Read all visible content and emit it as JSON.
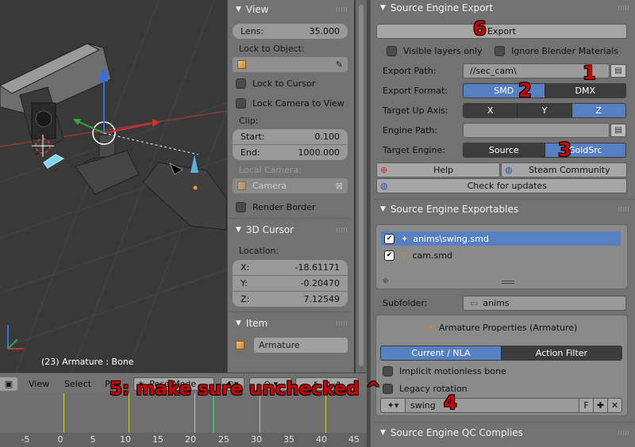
{
  "viewport": {
    "status_text": "(23) Armature : Bone"
  },
  "view_panel": {
    "view_header": "View",
    "lens_label": "Lens:",
    "lens_value": "35.000",
    "lock_to_object_label": "Lock to Object:",
    "lock_to_cursor": "Lock to Cursor",
    "lock_camera_to_view": "Lock Camera to View",
    "clip_label": "Clip:",
    "clip_start_label": "Start:",
    "clip_start_value": "0.100",
    "clip_end_label": "End:",
    "clip_end_value": "1000.000",
    "local_camera_label": "Local Camera:",
    "local_camera_value": "Camera",
    "render_border": "Render Border",
    "cursor_header": "3D Cursor",
    "location_label": "Location:",
    "x_label": "X:",
    "x_value": "-18.61171",
    "y_label": "Y:",
    "y_value": "-0.20470",
    "z_label": "Z:",
    "z_value": "7.12549",
    "item_header": "Item",
    "item_name": "Armature"
  },
  "export_panel": {
    "header": "Source Engine Export",
    "export_button": "Export",
    "visible_layers_only": "Visible layers only",
    "ignore_blender_materials": "Ignore Blender Materials",
    "export_path_label": "Export Path:",
    "export_path_value": "//sec_cam\\",
    "export_format_label": "Export Format:",
    "formats": [
      "SMD",
      "DMX"
    ],
    "target_up_axis_label": "Target Up Axis:",
    "axes": [
      "X",
      "Y",
      "Z"
    ],
    "engine_path_label": "Engine Path:",
    "engine_path_value": "",
    "target_engine_label": "Target Engine:",
    "engines": [
      "Source",
      "GoldSrc"
    ],
    "help_button": "Help",
    "community_button": "Steam Community",
    "updates_button": "Check for updates"
  },
  "exportables_panel": {
    "header": "Source Engine Exportables",
    "items": [
      "anims\\swing.smd",
      "cam.smd"
    ],
    "subfolder_label": "Subfolder:",
    "subfolder_value": "anims",
    "armature_props": "Armature Properties (Armature)",
    "tabs": [
      "Current / NLA",
      "Action Filter"
    ],
    "implicit_motionless_bone": "Implicit motionless bone",
    "legacy_rotation": "Legacy rotation",
    "action_name": "swing",
    "fake_user": "F"
  },
  "qc_panel": {
    "header": "Source Engine QC Complies"
  },
  "timeline": {
    "menu_view": "View",
    "menu_select": "Select",
    "menu_pose": "P",
    "mode": "Pose Mode",
    "ticks": [
      "-5",
      "0",
      "5",
      "10",
      "15",
      "20",
      "25",
      "30",
      "35",
      "40",
      "45"
    ]
  },
  "annotations": {
    "n1": "1",
    "n2": "2",
    "n3": "3",
    "n4": "4",
    "n5": "5:  make sure unchecked ^",
    "n6": "6"
  },
  "colors": {
    "accent_blue": "#5680c2",
    "annotation_red": "#d10000"
  }
}
